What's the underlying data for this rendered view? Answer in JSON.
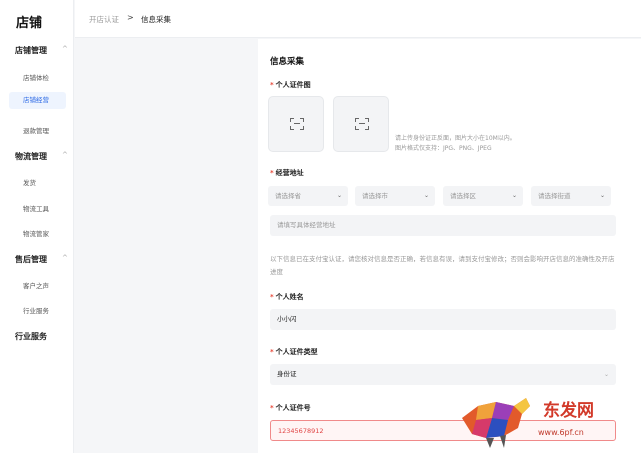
{
  "sidebar": {
    "title": "店铺",
    "groups": [
      {
        "label": "店铺管理",
        "items": [
          "店铺体检",
          "店铺经营",
          "退款管理"
        ]
      },
      {
        "label": "物流管理",
        "items": [
          "发货",
          "物流工具",
          "物流管家"
        ]
      },
      {
        "label": "售后管理",
        "items": [
          "客户之声",
          "行业服务"
        ]
      },
      {
        "label": "行业服务"
      }
    ],
    "active_item": "店铺经营",
    "caret": "^"
  },
  "breadcrumb": {
    "prev": "开店认证",
    "sep": ">",
    "current": "信息采集"
  },
  "form": {
    "section_title": "信息采集",
    "required_mark": "*",
    "id_photo": {
      "label": "个人证件图",
      "hint_line1": "请上传身份证正反面，图片大小在10M以内。",
      "hint_line2": "图片格式仅支持：JPG、PNG、JPEG"
    },
    "address": {
      "label": "经营地址",
      "selects": [
        "请选择省",
        "请选择市",
        "请选择区",
        "请选择街道"
      ],
      "detail_placeholder": "请填写具体经营地址"
    },
    "notice": "以下信息已在支付宝认证，请您核对信息是否正确，若信息有误，请到支付宝修改；否则会影响开店信息的准确性及开店进度",
    "name": {
      "label": "个人姓名",
      "value": "小小闪"
    },
    "id_type": {
      "label": "个人证件类型",
      "value": "身份证"
    },
    "id_number": {
      "label": "个人证件号",
      "value": "12345678912"
    }
  },
  "watermark": {
    "text": "东发网",
    "url": "www.6pf.cn"
  },
  "colors": {
    "accent": "#2f6be6",
    "required": "#e84b3c",
    "error": "#e04545"
  }
}
